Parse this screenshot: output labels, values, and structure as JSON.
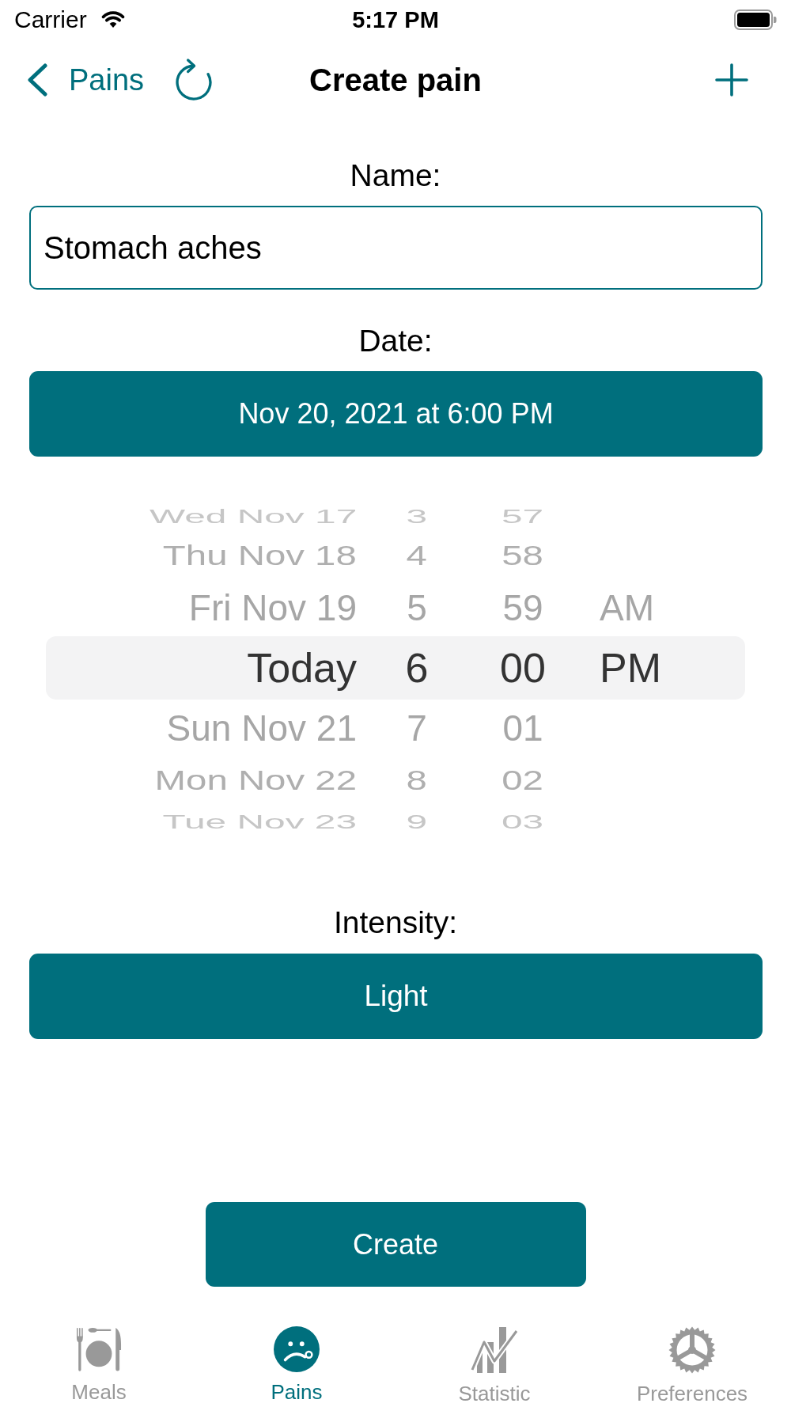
{
  "status_bar": {
    "carrier": "Carrier",
    "time": "5:17 PM"
  },
  "nav_bar": {
    "back_label": "Pains",
    "title": "Create pain"
  },
  "name_field": {
    "label": "Name:",
    "value": "Stomach aches"
  },
  "date_field": {
    "label": "Date:",
    "value": "Nov 20, 2021 at 6:00 PM"
  },
  "date_picker": {
    "rows": [
      {
        "day": "Wed Nov 17",
        "hour": "3",
        "minute": "57",
        "selected": false
      },
      {
        "day": "Thu Nov 18",
        "hour": "4",
        "minute": "58",
        "selected": false
      },
      {
        "day": "Fri Nov 19",
        "hour": "5",
        "minute": "59",
        "period": "AM",
        "selected": false
      },
      {
        "day": "Today",
        "hour": "6",
        "minute": "00",
        "period": "PM",
        "selected": true
      },
      {
        "day": "Sun Nov 21",
        "hour": "7",
        "minute": "01",
        "selected": false
      },
      {
        "day": "Mon Nov 22",
        "hour": "8",
        "minute": "02",
        "selected": false
      },
      {
        "day": "Tue Nov 23",
        "hour": "9",
        "minute": "03",
        "selected": false
      }
    ]
  },
  "intensity_field": {
    "label": "Intensity:",
    "value": "Light"
  },
  "create_button": {
    "label": "Create"
  },
  "tab_bar": {
    "tabs": [
      {
        "label": "Meals",
        "selected": false
      },
      {
        "label": "Pains",
        "selected": true
      },
      {
        "label": "Statistic",
        "selected": false
      },
      {
        "label": "Preferences",
        "selected": false
      }
    ]
  }
}
